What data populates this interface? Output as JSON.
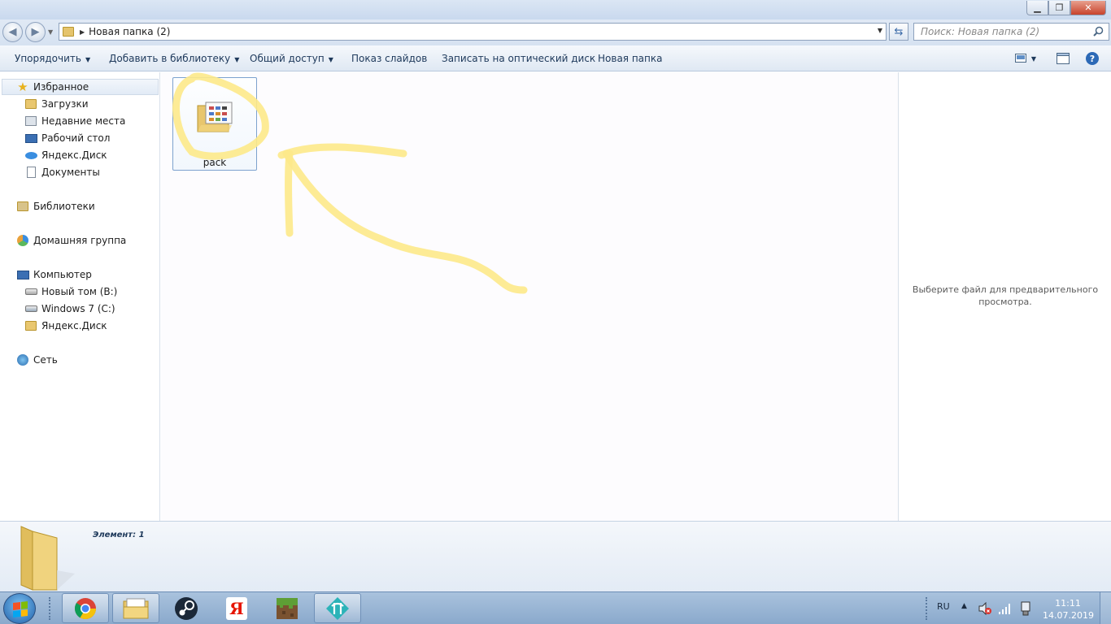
{
  "window": {
    "controls": {
      "minimize": "▁",
      "maximize": "❐",
      "close": "✕"
    }
  },
  "address_bar": {
    "path_folder_icon": "folder-icon",
    "path": "Новая папка (2)",
    "search_placeholder": "Поиск: Новая папка (2)"
  },
  "toolbar": {
    "organize": "Упорядочить",
    "add_to_library": "Добавить в библиотеку",
    "share": "Общий доступ",
    "slideshow": "Показ слайдов",
    "burn": "Записать на оптический диск",
    "new_folder": "Новая папка"
  },
  "nav": {
    "favorites": "Избранное",
    "downloads": "Загрузки",
    "recent": "Недавние места",
    "desktop": "Рабочий стол",
    "yandex_disk_fav": "Яндекс.Диск",
    "documents": "Документы",
    "libraries": "Библиотеки",
    "homegroup": "Домашняя группа",
    "computer": "Компьютер",
    "drive_b": "Новый том (B:)",
    "drive_c": "Windows 7 (C:)",
    "yandex_disk_comp": "Яндекс.Диск",
    "network": "Сеть"
  },
  "content": {
    "files": [
      {
        "name": "pack",
        "icon": "folder-icon"
      }
    ],
    "annotation_color": "#fde98a"
  },
  "preview": {
    "message": "Выберите файл для предварительного просмотра."
  },
  "details": {
    "count": "Элемент: 1"
  },
  "taskbar": {
    "apps": [
      "chrome-icon",
      "explorer-icon",
      "steam-icon",
      "yandex-icon",
      "minecraft-icon",
      "app-icon"
    ],
    "language": "RU",
    "time": "11:11",
    "date": "14.07.2019"
  }
}
